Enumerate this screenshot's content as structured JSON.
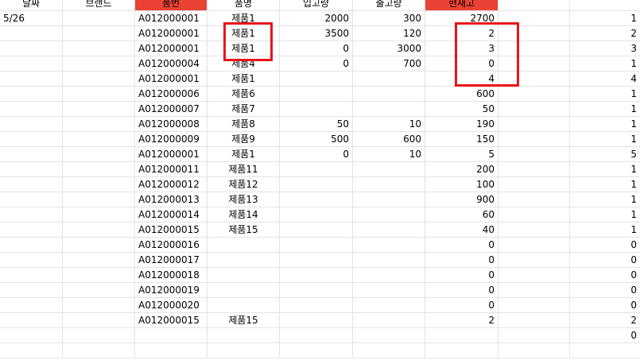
{
  "header": {
    "date": "날짜",
    "brand": "브랜드",
    "product_no": "품번",
    "product_name": "품명",
    "inbound": "입고량",
    "outbound": "출고량",
    "stock": "현재고",
    "extra": "",
    "count": ""
  },
  "rows": [
    {
      "date": "5/26",
      "brand": "",
      "code": "A012000001",
      "name": "제품1",
      "in": "2000",
      "out": "300",
      "stock": "2700",
      "count": "1"
    },
    {
      "date": "",
      "brand": "",
      "code": "A012000001",
      "name": "제품1",
      "in": "3500",
      "out": "120",
      "stock": "2",
      "count": "2"
    },
    {
      "date": "",
      "brand": "",
      "code": "A012000001",
      "name": "제품1",
      "in": "0",
      "out": "3000",
      "stock": "3",
      "count": "3"
    },
    {
      "date": "",
      "brand": "",
      "code": "A012000004",
      "name": "제품4",
      "in": "0",
      "out": "700",
      "stock": "0",
      "count": "1"
    },
    {
      "date": "",
      "brand": "",
      "code": "A012000001",
      "name": "제품1",
      "in": "",
      "out": "",
      "stock": "4",
      "count": "4"
    },
    {
      "date": "",
      "brand": "",
      "code": "A012000006",
      "name": "제품6",
      "in": "",
      "out": "",
      "stock": "600",
      "count": "1"
    },
    {
      "date": "",
      "brand": "",
      "code": "A012000007",
      "name": "제품7",
      "in": "",
      "out": "",
      "stock": "50",
      "count": "1"
    },
    {
      "date": "",
      "brand": "",
      "code": "A012000008",
      "name": "제품8",
      "in": "50",
      "out": "10",
      "stock": "190",
      "count": "1"
    },
    {
      "date": "",
      "brand": "",
      "code": "A012000009",
      "name": "제품9",
      "in": "500",
      "out": "600",
      "stock": "150",
      "count": "1"
    },
    {
      "date": "",
      "brand": "",
      "code": "A012000001",
      "name": "제품1",
      "in": "0",
      "out": "10",
      "stock": "5",
      "count": "5"
    },
    {
      "date": "",
      "brand": "",
      "code": "A012000011",
      "name": "제품11",
      "in": "",
      "out": "",
      "stock": "200",
      "count": "1"
    },
    {
      "date": "",
      "brand": "",
      "code": "A012000012",
      "name": "제품12",
      "in": "",
      "out": "",
      "stock": "100",
      "count": "1"
    },
    {
      "date": "",
      "brand": "",
      "code": "A012000013",
      "name": "제품13",
      "in": "",
      "out": "",
      "stock": "900",
      "count": "1"
    },
    {
      "date": "",
      "brand": "",
      "code": "A012000014",
      "name": "제품14",
      "in": "",
      "out": "",
      "stock": "60",
      "count": "1"
    },
    {
      "date": "",
      "brand": "",
      "code": "A012000015",
      "name": "제품15",
      "in": "",
      "out": "",
      "stock": "40",
      "count": "1"
    },
    {
      "date": "",
      "brand": "",
      "code": "A012000016",
      "name": "",
      "in": "",
      "out": "",
      "stock": "0",
      "count": "0"
    },
    {
      "date": "",
      "brand": "",
      "code": "A012000017",
      "name": "",
      "in": "",
      "out": "",
      "stock": "0",
      "count": "0"
    },
    {
      "date": "",
      "brand": "",
      "code": "A012000018",
      "name": "",
      "in": "",
      "out": "",
      "stock": "0",
      "count": "0"
    },
    {
      "date": "",
      "brand": "",
      "code": "A012000019",
      "name": "",
      "in": "",
      "out": "",
      "stock": "0",
      "count": "0"
    },
    {
      "date": "",
      "brand": "",
      "code": "A012000020",
      "name": "",
      "in": "",
      "out": "",
      "stock": "0",
      "count": "0"
    },
    {
      "date": "",
      "brand": "",
      "code": "A012000015",
      "name": "제품15",
      "in": "",
      "out": "",
      "stock": "2",
      "count": "2"
    },
    {
      "date": "",
      "brand": "",
      "code": "",
      "name": "",
      "in": "",
      "out": "",
      "stock": "",
      "count": "0"
    },
    {
      "date": "",
      "brand": "",
      "code": "",
      "name": "",
      "in": "",
      "out": "",
      "stock": "",
      "count": ""
    }
  ],
  "colors": {
    "header_highlight": "#ea4335",
    "annotation_box": "#e8151b",
    "grid_line": "#e2e3e3"
  }
}
